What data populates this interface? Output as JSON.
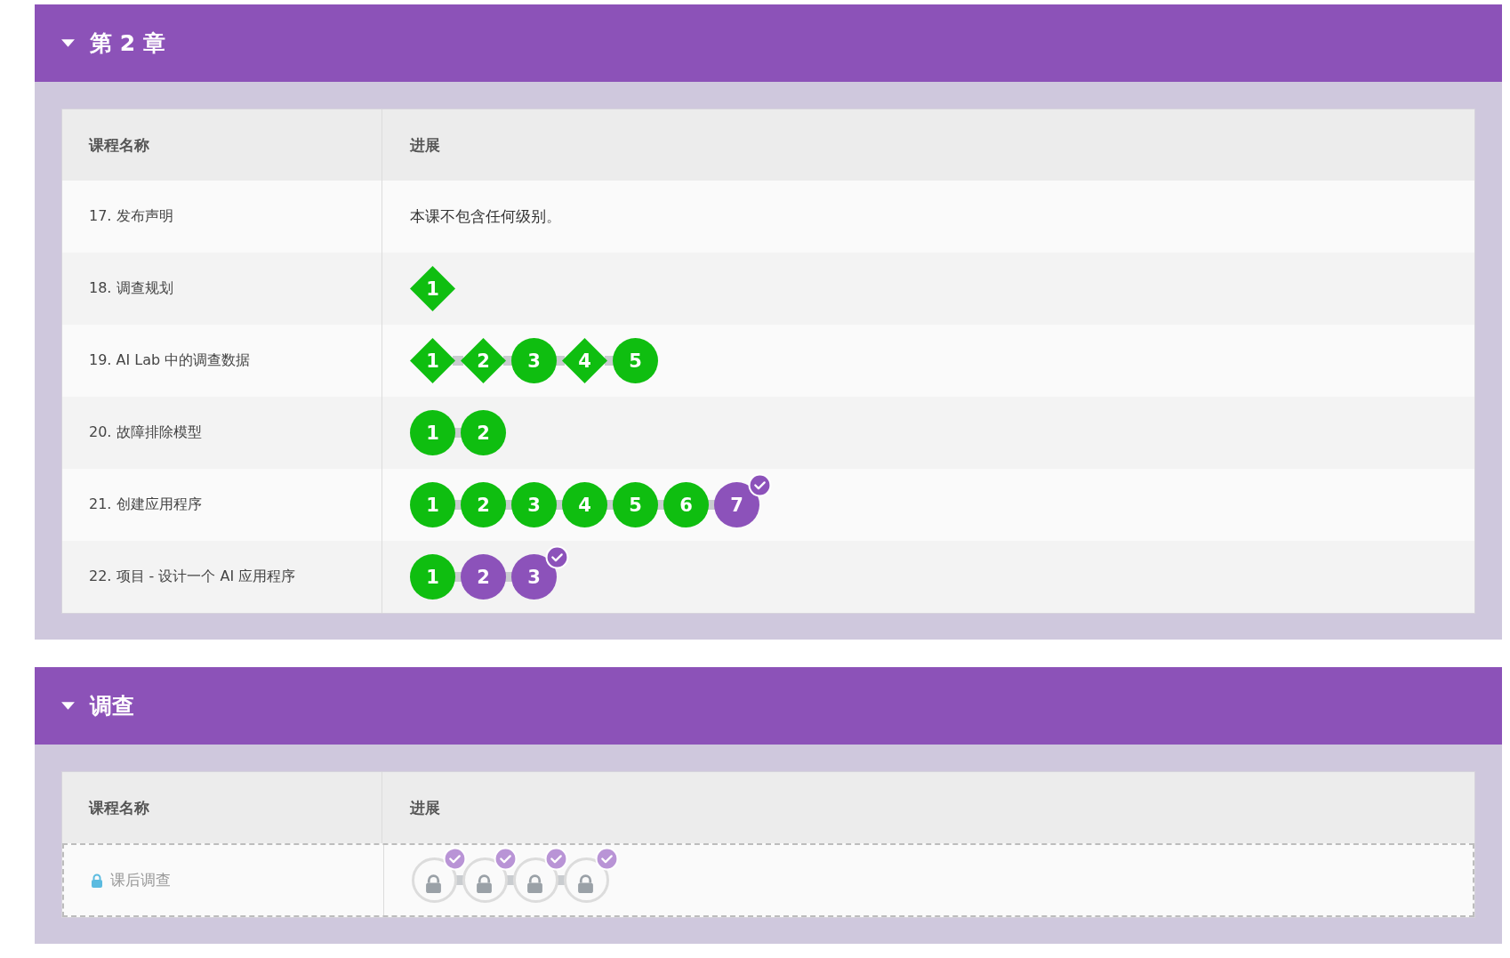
{
  "sections": [
    {
      "title": "第 2 章",
      "expanded": true,
      "columns": [
        "课程名称",
        "进展"
      ],
      "rows": [
        {
          "name": "17. 发布声明",
          "locked": false,
          "note": "本课不包含任何级别。",
          "levels": []
        },
        {
          "name": "18. 调查规划",
          "locked": false,
          "levels": [
            {
              "label": "1",
              "kind": "diamond",
              "perfect": true,
              "checked": false
            }
          ]
        },
        {
          "name": "19. AI Lab 中的调查数据",
          "locked": false,
          "levels": [
            {
              "label": "1",
              "kind": "diamond",
              "perfect": true,
              "checked": false
            },
            {
              "label": "2",
              "kind": "diamond",
              "perfect": true,
              "checked": false
            },
            {
              "label": "3",
              "kind": "circle",
              "perfect": true,
              "checked": false
            },
            {
              "label": "4",
              "kind": "diamond",
              "perfect": true,
              "checked": false
            },
            {
              "label": "5",
              "kind": "circle",
              "perfect": true,
              "checked": false
            }
          ]
        },
        {
          "name": "20. 故障排除模型",
          "locked": false,
          "levels": [
            {
              "label": "1",
              "kind": "circle",
              "perfect": true,
              "checked": false
            },
            {
              "label": "2",
              "kind": "circle",
              "perfect": true,
              "checked": false
            }
          ]
        },
        {
          "name": "21. 创建应用程序",
          "locked": false,
          "levels": [
            {
              "label": "1",
              "kind": "circle",
              "perfect": true,
              "checked": false
            },
            {
              "label": "2",
              "kind": "circle",
              "perfect": true,
              "checked": false
            },
            {
              "label": "3",
              "kind": "circle",
              "perfect": true,
              "checked": false
            },
            {
              "label": "4",
              "kind": "circle",
              "perfect": true,
              "checked": false
            },
            {
              "label": "5",
              "kind": "circle",
              "perfect": true,
              "checked": false
            },
            {
              "label": "6",
              "kind": "circle",
              "perfect": true,
              "checked": false
            },
            {
              "label": "7",
              "kind": "circle",
              "perfect": false,
              "checked": true
            }
          ]
        },
        {
          "name": "22. 项目 - 设计一个 AI 应用程序",
          "locked": false,
          "levels": [
            {
              "label": "1",
              "kind": "circle",
              "perfect": true,
              "checked": false
            },
            {
              "label": "2",
              "kind": "circle",
              "perfect": false,
              "checked": false
            },
            {
              "label": "3",
              "kind": "circle",
              "perfect": false,
              "checked": true
            }
          ]
        }
      ]
    },
    {
      "title": "调查",
      "expanded": true,
      "columns": [
        "课程名称",
        "进展"
      ],
      "rows": [
        {
          "name": "课后调查",
          "locked": true,
          "levels": [
            {
              "kind": "locked",
              "checked": true
            },
            {
              "kind": "locked",
              "checked": true
            },
            {
              "kind": "locked",
              "checked": true
            },
            {
              "kind": "locked",
              "checked": true
            }
          ]
        }
      ]
    }
  ]
}
